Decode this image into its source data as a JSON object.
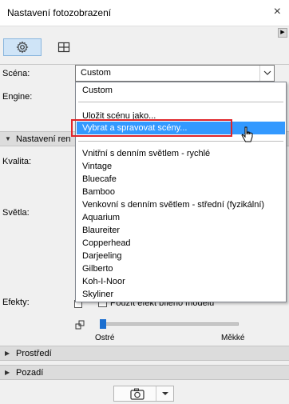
{
  "window": {
    "title": "Nastavení fotozobrazení",
    "close_glyph": "×"
  },
  "toolbar": {
    "tabs": [
      {
        "icon": "gear-icon",
        "selected": true
      },
      {
        "icon": "layout-grid-icon",
        "selected": false
      }
    ],
    "expander_glyph": "▶"
  },
  "scena": {
    "label": "Scéna:",
    "value": "Custom"
  },
  "engine": {
    "label": "Engine:"
  },
  "section_nastaveni": {
    "label": "Nastavení ren"
  },
  "kvalita": {
    "label": "Kvalita:"
  },
  "svetla": {
    "label": "Světla:"
  },
  "efekty": {
    "label": "Efekty:",
    "checkbox_label": "Použít efekt bílého modelu",
    "checked": false
  },
  "slider": {
    "min_label": "Ostré",
    "max_label": "Měkké",
    "value_fraction": 0.0
  },
  "sections": [
    {
      "label": "Prostředí",
      "expanded": false
    },
    {
      "label": "Pozadí",
      "expanded": false
    }
  ],
  "dropdown": {
    "current": "Custom",
    "actions": [
      "Uložit scénu jako...",
      "Vybrat a spravovat scény..."
    ],
    "highlighted": "Vybrat a spravovat scény...",
    "presets": [
      "Vnitřní s denním světlem - rychlé",
      "Vintage",
      "Bluecafe",
      "Bamboo",
      "Venkovní s denním světlem - střední (fyzikální)",
      "Aquarium",
      "Blaureiter",
      "Copperhead",
      "Darjeeling",
      "Gilberto",
      "Koh-I-Noor",
      "Skyliner"
    ]
  },
  "colors": {
    "highlight": "#3399ff",
    "callout": "#e0262a",
    "tab_selected": "#cfe4f7"
  }
}
